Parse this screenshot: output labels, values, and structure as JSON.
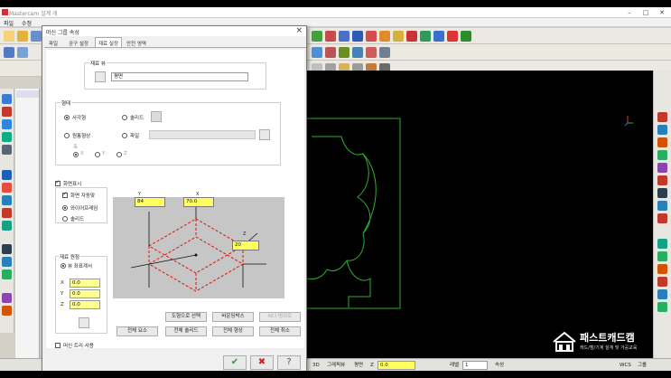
{
  "app": {
    "title": "Mastercam 설계 개",
    "menu": [
      "파일",
      "수정"
    ]
  },
  "dialog": {
    "title": "머신 그룹 속성",
    "close_icon": "×",
    "tabs": [
      "파일",
      "공구 설정",
      "재료 설정",
      "안전 영역"
    ],
    "active_tab": 2,
    "stock_view": {
      "group_label": "재료 뷰",
      "view_value": "평면"
    },
    "shape": {
      "group_label": "형태",
      "rect_label": "사각형",
      "solid_label": "솔리드",
      "cylinder_label": "원통형상",
      "file_label": "파일",
      "axis_label": "축",
      "axis_options": [
        "X",
        "Y",
        "Z"
      ]
    },
    "display": {
      "show_label": "화면표시",
      "fit_label": "화면 자동맞",
      "wireframe_label": "와이어프레임",
      "solid_label": "솔리드"
    },
    "origin": {
      "group_label": "재료 원점",
      "view_coord_label": "뷰 좌표계서",
      "x_label": "X",
      "y_label": "Y",
      "z_label": "Z",
      "x_value": "0.0",
      "y_value": "0.0",
      "z_value": "0.0"
    },
    "preview": {
      "y_label": "Y",
      "x_label": "X",
      "y_value": "84",
      "x_value": "70.0",
      "z_label": "Z",
      "z_value": "20"
    },
    "buttons": {
      "rectangle_select": "도형으로 선택",
      "bounding_box": "바운딩박스",
      "ncI_file": "NCI 범위로",
      "all_entities": "전체 요소",
      "all_solids": "전체 솔리드",
      "all_shapes": "전체 형상",
      "all_cancel": "전체 취소"
    },
    "machine_group_check": "머신 트리 사용",
    "footer": {
      "ok_icon": "✔",
      "cancel_icon": "✖",
      "help_icon": "?"
    }
  },
  "statusbar": {
    "mode": "3D",
    "plane_label": "그래픽뷰",
    "cplane_label": "평면",
    "z_label": "Z",
    "z_value": "0.0",
    "level_label": "레벨",
    "level_value": "1",
    "attr_label": "속성",
    "wcs_label": "WCS",
    "group_label": "그룹"
  },
  "watermark": {
    "title": "패스트캐드캠",
    "subtitle": "캐드/캠/기계 설계 및 가공교육"
  },
  "colors": {
    "accent_yellow": "#ffff60",
    "geometry_green": "#2fae2f",
    "preview_red": "#e01010"
  }
}
